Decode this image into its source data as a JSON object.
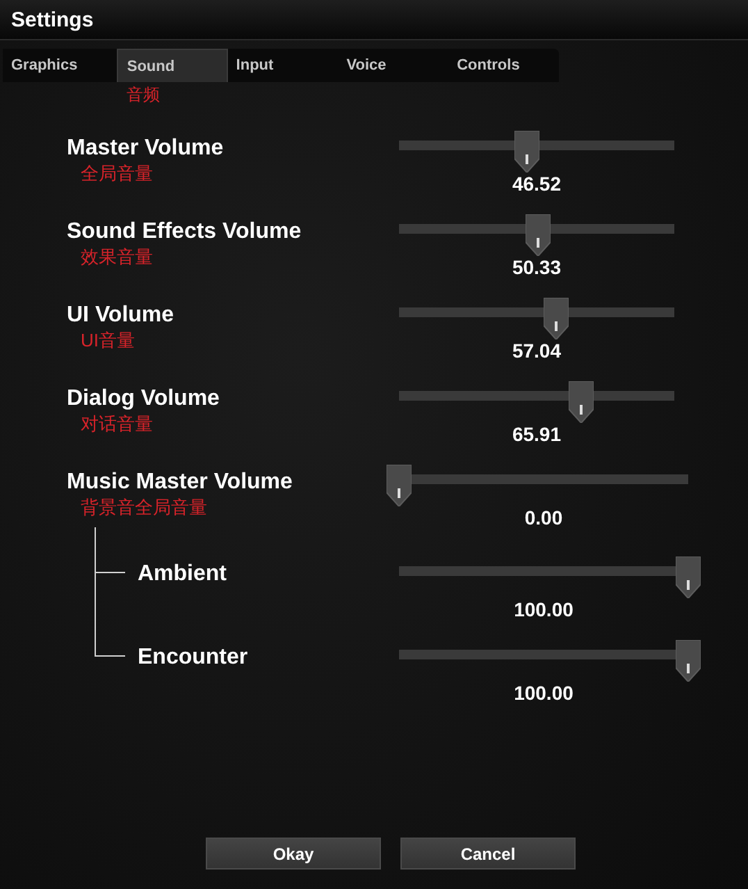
{
  "window": {
    "title": "Settings"
  },
  "tabs": [
    {
      "label": "Graphics",
      "selected": false
    },
    {
      "label": "Sound",
      "selected": true
    },
    {
      "label": "Input",
      "selected": false
    },
    {
      "label": "Voice",
      "selected": false
    },
    {
      "label": "Controls",
      "selected": false
    }
  ],
  "tab_note": "音频",
  "settings": [
    {
      "label": "Master Volume",
      "note": "全局音量",
      "level": 0.4652,
      "reading": "46.52"
    },
    {
      "label": "Sound Effects Volume",
      "note": "效果音量",
      "level": 0.5033,
      "reading": "50.33"
    },
    {
      "label": "UI Volume",
      "note": "UI音量",
      "level": 0.5704,
      "reading": "57.04"
    },
    {
      "label": "Dialog Volume",
      "note": "对话音量",
      "level": 0.6591,
      "reading": "65.91"
    },
    {
      "label": "Music Master Volume",
      "note": "背景音全局音量",
      "level": 0,
      "reading": "0.00",
      "children": [
        {
          "label": "Ambient",
          "level": 1,
          "reading": "100.00"
        },
        {
          "label": "Encounter",
          "level": 1,
          "reading": "100.00"
        }
      ]
    }
  ],
  "buttons": [
    "Okay",
    "Cancel"
  ]
}
